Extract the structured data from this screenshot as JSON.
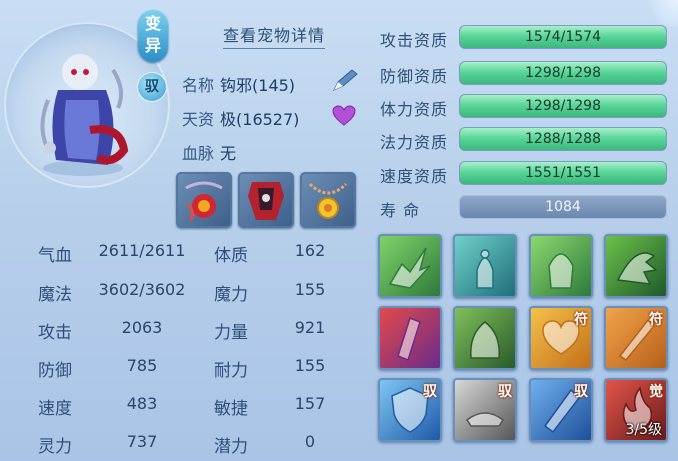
{
  "pet": {
    "variant_badge": "变异",
    "tame_badge": "驭",
    "detail_link": "查看宠物详情",
    "name_label": "名称",
    "name_value": "钩邪(145)",
    "talent_label": "天资",
    "talent_value": "极(16527)",
    "bloodline_label": "血脉",
    "bloodline_value": "无"
  },
  "equipment": [
    {
      "icon": "necklace-red-icon"
    },
    {
      "icon": "armor-red-icon"
    },
    {
      "icon": "amulet-gold-icon"
    }
  ],
  "stats": {
    "rows": [
      {
        "left_label": "气血",
        "left_value": "2611/2611",
        "right_label": "体质",
        "right_value": "162"
      },
      {
        "left_label": "魔法",
        "left_value": "3602/3602",
        "right_label": "魔力",
        "right_value": "155"
      },
      {
        "left_label": "攻击",
        "left_value": "2063",
        "right_label": "力量",
        "right_value": "921"
      },
      {
        "left_label": "防御",
        "left_value": "785",
        "right_label": "耐力",
        "right_value": "155"
      },
      {
        "left_label": "速度",
        "left_value": "483",
        "right_label": "敏捷",
        "right_value": "157"
      },
      {
        "left_label": "灵力",
        "left_value": "737",
        "right_label": "潜力",
        "right_value": "0"
      }
    ]
  },
  "aptitudes": [
    {
      "label": "攻击资质",
      "value": "1574/1574",
      "fill": 1.0
    },
    {
      "label": "防御资质",
      "value": "1298/1298",
      "fill": 1.0
    },
    {
      "label": "体力资质",
      "value": "1298/1298",
      "fill": 1.0
    },
    {
      "label": "法力资质",
      "value": "1288/1288",
      "fill": 1.0
    },
    {
      "label": "速度资质",
      "value": "1551/1551",
      "fill": 1.0
    }
  ],
  "life": {
    "label": "寿    命",
    "value": "1084"
  },
  "skills": [
    {
      "icon": "green-dash-skill-icon",
      "tag": "",
      "level": ""
    },
    {
      "icon": "teal-figure-skill-icon",
      "tag": "",
      "level": ""
    },
    {
      "icon": "green-figure-skill-icon",
      "tag": "",
      "level": ""
    },
    {
      "icon": "green-claw-skill-icon",
      "tag": "",
      "level": ""
    },
    {
      "icon": "red-talisman-skill-icon",
      "tag": "",
      "level": ""
    },
    {
      "icon": "green-giant-skill-icon",
      "tag": "",
      "level": ""
    },
    {
      "icon": "heart-charm-skill-icon",
      "tag": "符",
      "level": ""
    },
    {
      "icon": "sword-charm-skill-icon",
      "tag": "符",
      "level": ""
    },
    {
      "icon": "shield-skill-icon",
      "tag": "驭",
      "level": ""
    },
    {
      "icon": "lamp-skill-icon",
      "tag": "驭",
      "level": ""
    },
    {
      "icon": "blade-skill-icon",
      "tag": "驭",
      "level": ""
    },
    {
      "icon": "awaken-flame-skill-icon",
      "tag": "觉",
      "level": "3/5级"
    }
  ],
  "colors": {
    "accent": "#3ab87c",
    "panel": "#b7cfea",
    "text": "#2f4f78"
  }
}
